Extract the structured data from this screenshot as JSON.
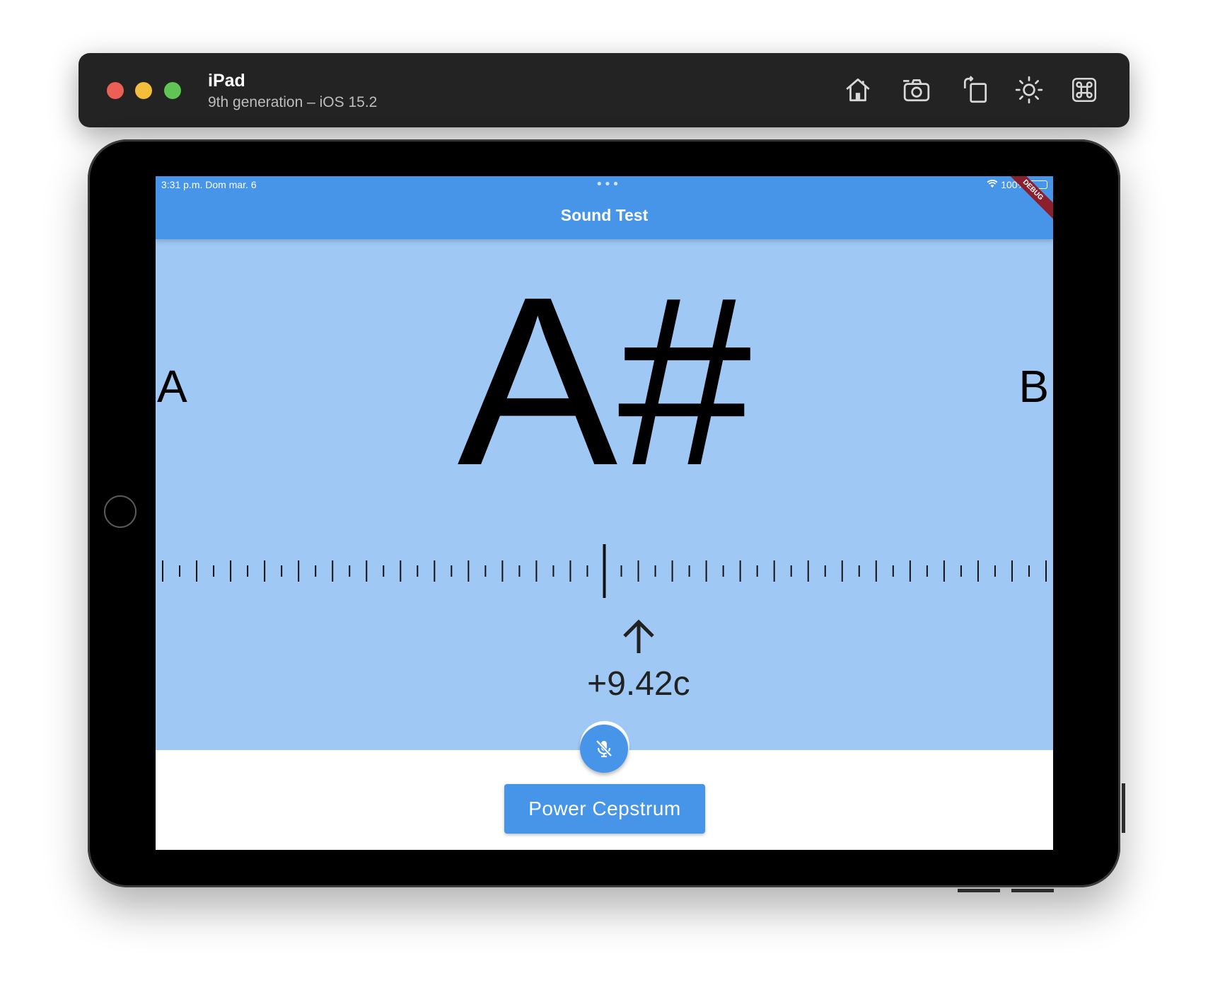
{
  "simulator": {
    "device_name": "iPad",
    "device_subtitle": "9th generation – iOS 15.2",
    "toolbar_icons": [
      "home-icon",
      "screenshot-icon",
      "rotate-icon",
      "appearance-icon",
      "command-icon"
    ]
  },
  "status_bar": {
    "time": "3:31 p.m.   Dom mar. 6",
    "dots": "•••",
    "battery_percent": "100%",
    "battery_level": 1.0
  },
  "app_bar": {
    "title": "Sound Test",
    "debug_label": "DEBUG"
  },
  "tuner": {
    "current_note": "A#",
    "previous_note": "A",
    "next_note": "B",
    "cents_label": "+9.42c",
    "cents_value": 9.42,
    "scale_range_cents": [
      -50,
      50
    ]
  },
  "controls": {
    "mic_state": "muted",
    "method_button_label": "Power Cepstrum"
  },
  "colors": {
    "primary": "#4795e8",
    "background": "#9fc8f5",
    "debug_ribbon": "#8b1f2e"
  }
}
